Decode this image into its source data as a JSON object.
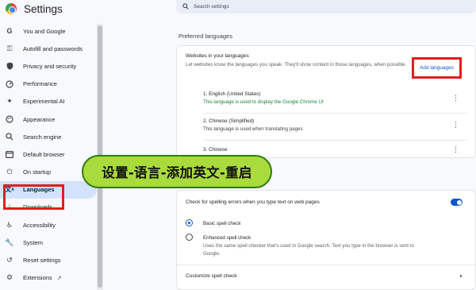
{
  "app": {
    "title": "Settings"
  },
  "search": {
    "placeholder": "Search settings"
  },
  "sidebar": {
    "items": [
      {
        "label": "You and Google",
        "icon": "google-g-icon"
      },
      {
        "label": "Autofill and passwords",
        "icon": "key-icon"
      },
      {
        "label": "Privacy and security",
        "icon": "shield-icon"
      },
      {
        "label": "Performance",
        "icon": "speedometer-icon"
      },
      {
        "label": "Experimental AI",
        "icon": "sparkle-icon"
      },
      {
        "label": "Appearance",
        "icon": "palette-icon"
      },
      {
        "label": "Search engine",
        "icon": "search-icon"
      },
      {
        "label": "Default browser",
        "icon": "browser-window-icon"
      },
      {
        "label": "On startup",
        "icon": "power-icon"
      },
      {
        "label": "Languages",
        "icon": "translate-icon",
        "active": true
      },
      {
        "label": "Downloads",
        "icon": "download-icon"
      },
      {
        "label": "Accessibility",
        "icon": "accessibility-icon"
      },
      {
        "label": "System",
        "icon": "wrench-icon"
      },
      {
        "label": "Reset settings",
        "icon": "reset-icon"
      },
      {
        "label": "Extensions",
        "icon": "puzzle-icon"
      }
    ]
  },
  "preferred_languages": {
    "section_title": "Preferred languages",
    "heading": "Websites in your languages",
    "description": "Let websites know the languages you speak. They'll show content in those languages, when possible.",
    "add_button": "Add languages",
    "languages": [
      {
        "name": "1. English (United States)",
        "note": "This language is used to display the Google Chrome UI"
      },
      {
        "name": "2. Chinese (Simplified)",
        "note": "This language is used when translating pages"
      },
      {
        "name": "3. Chinese",
        "note": ""
      }
    ]
  },
  "spell_check": {
    "toggle_label": "Check for spelling errors when you type text on web pages",
    "toggle_on": true,
    "basic_label": "Basic spell check",
    "enhanced_label": "Enhanced spell check",
    "enhanced_desc": "Uses the same spell checker that's used in Google search. Text you type in the browser is sent to Google.",
    "selected": "basic",
    "customize_label": "Customize spell check"
  },
  "overlay": {
    "banner_text": "设置-语言-添加英文-重启"
  },
  "colors": {
    "accent": "#0b57d0",
    "highlight": "#e01e1e",
    "banner": "#a9db3c",
    "active_nav": "#d3e3fd"
  }
}
